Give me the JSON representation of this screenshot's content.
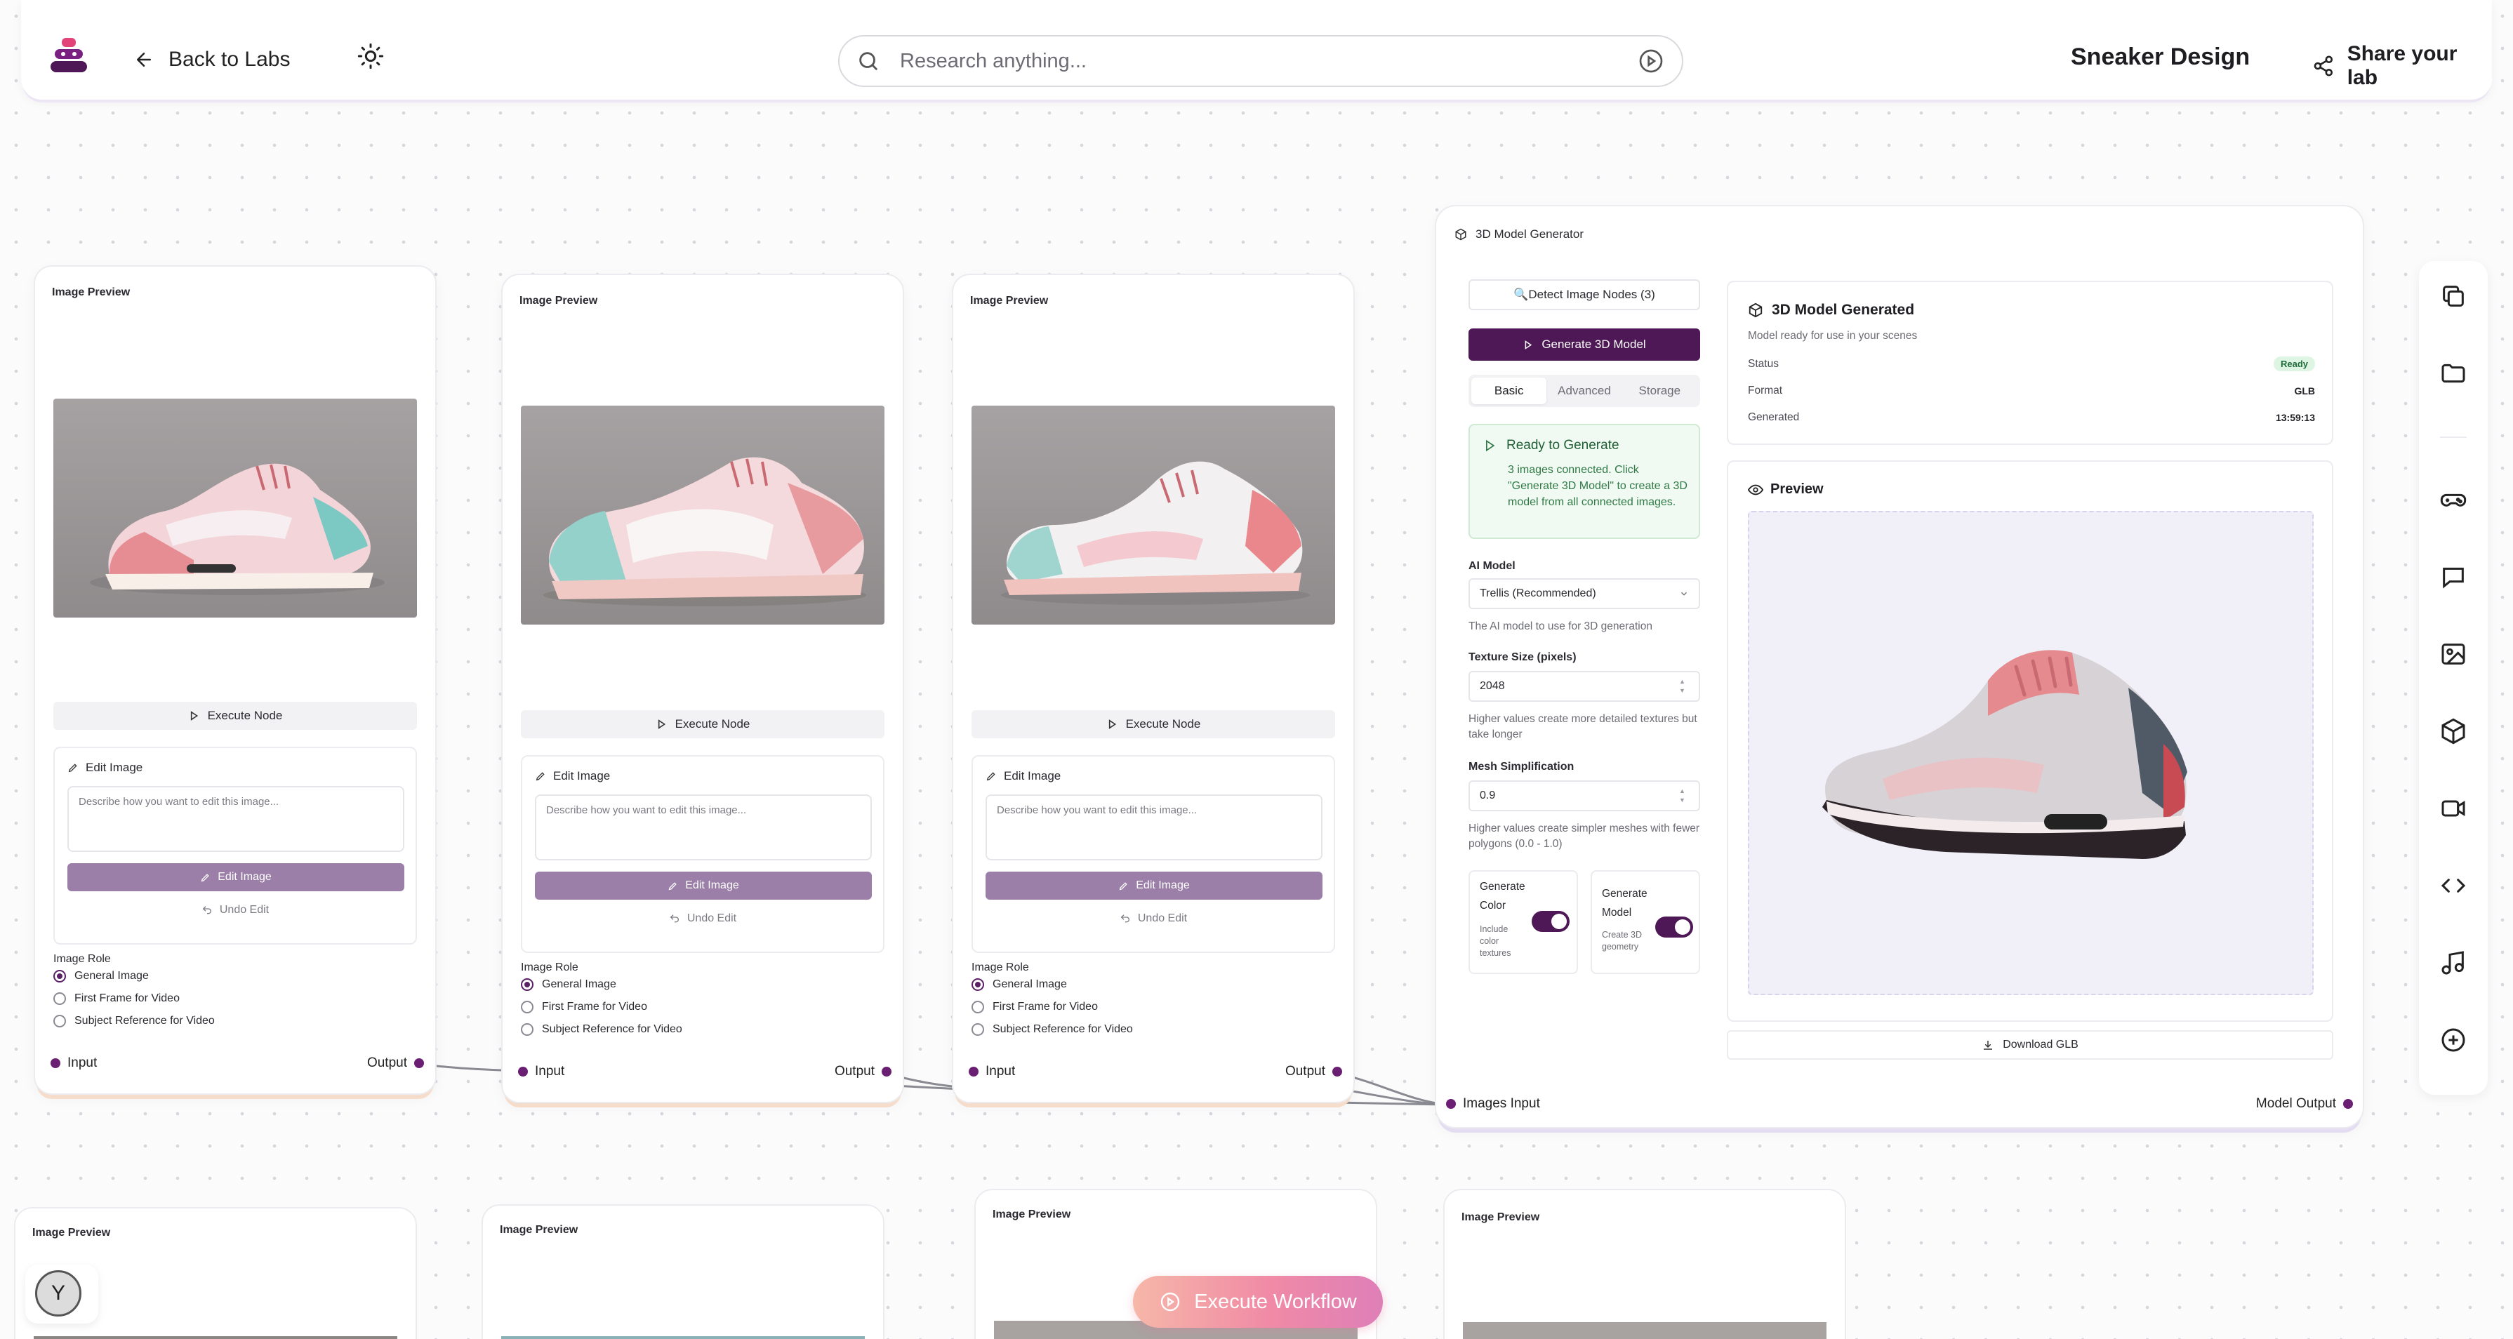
{
  "header": {
    "back_label": "Back to Labs",
    "search_placeholder": "Research anything...",
    "lab_title": "Sneaker Design",
    "share_label": "Share your lab"
  },
  "image_nodes": [
    {
      "title": "Image Preview",
      "execute_label": "Execute Node",
      "edit_title": "Edit Image",
      "edit_placeholder": "Describe how you want to edit this image...",
      "edit_button": "Edit Image",
      "undo_label": "Undo Edit",
      "role_label": "Image Role",
      "roles": [
        "General Image",
        "First Frame for Video",
        "Subject Reference for Video"
      ],
      "selected_role": "General Image",
      "input_label": "Input",
      "output_label": "Output"
    },
    {
      "title": "Image Preview",
      "execute_label": "Execute Node",
      "edit_title": "Edit Image",
      "edit_placeholder": "Describe how you want to edit this image...",
      "edit_button": "Edit Image",
      "undo_label": "Undo Edit",
      "role_label": "Image Role",
      "roles": [
        "General Image",
        "First Frame for Video",
        "Subject Reference for Video"
      ],
      "selected_role": "General Image",
      "input_label": "Input",
      "output_label": "Output"
    },
    {
      "title": "Image Preview",
      "execute_label": "Execute Node",
      "edit_title": "Edit Image",
      "edit_placeholder": "Describe how you want to edit this image...",
      "edit_button": "Edit Image",
      "undo_label": "Undo Edit",
      "role_label": "Image Role",
      "roles": [
        "General Image",
        "First Frame for Video",
        "Subject Reference for Video"
      ],
      "selected_role": "General Image",
      "input_label": "Input",
      "output_label": "Output"
    }
  ],
  "generator": {
    "title": "3D Model Generator",
    "detect_label": "🔍Detect Image Nodes (3)",
    "generate_label": "Generate 3D Model",
    "tabs": [
      "Basic",
      "Advanced",
      "Storage"
    ],
    "active_tab": "Basic",
    "ready_title": "Ready to Generate",
    "ready_desc": "3 images connected. Click \"Generate 3D Model\" to create a 3D model from all connected images.",
    "ai_model_label": "AI Model",
    "ai_model_value": "Trellis (Recommended)",
    "ai_model_help": "The AI model to use for 3D generation",
    "texture_label": "Texture Size (pixels)",
    "texture_value": "2048",
    "texture_help": "Higher values create more detailed textures but take longer",
    "mesh_label": "Mesh Simplification",
    "mesh_value": "0.9",
    "mesh_help": "Higher values create simpler meshes with fewer polygons (0.0 - 1.0)",
    "gen_color_title": "Generate Color",
    "gen_color_sub": "Include color textures",
    "gen_color_on": true,
    "gen_model_title": "Generate Model",
    "gen_model_sub": "Create 3D geometry",
    "gen_model_on": true,
    "result_title": "3D Model Generated",
    "result_sub": "Model ready for use in your scenes",
    "status_label": "Status",
    "status_value": "Ready",
    "format_label": "Format",
    "format_value": "GLB",
    "generated_label": "Generated",
    "generated_value": "13:59:13",
    "preview_title": "Preview",
    "download_label": "Download GLB",
    "images_input_label": "Images Input",
    "model_output_label": "Model Output"
  },
  "bottom_nodes": [
    {
      "title": "Image Preview"
    },
    {
      "title": "Image Preview"
    },
    {
      "title": "Image Preview"
    },
    {
      "title": "Image Preview"
    }
  ],
  "avatar_initial": "Y",
  "execute_workflow_label": "Execute Workflow",
  "toolbar_icons": [
    "copy-icon",
    "folder-icon",
    "gamepad-icon",
    "chat-icon",
    "image-icon",
    "cube-icon",
    "video-icon",
    "code-icon",
    "music-icon",
    "plus-circle-icon"
  ],
  "colors": {
    "accent": "#4e1756",
    "port": "#6b1f72",
    "edit_button": "#9b7fa8",
    "ready_bg": "#f0f9f2"
  }
}
